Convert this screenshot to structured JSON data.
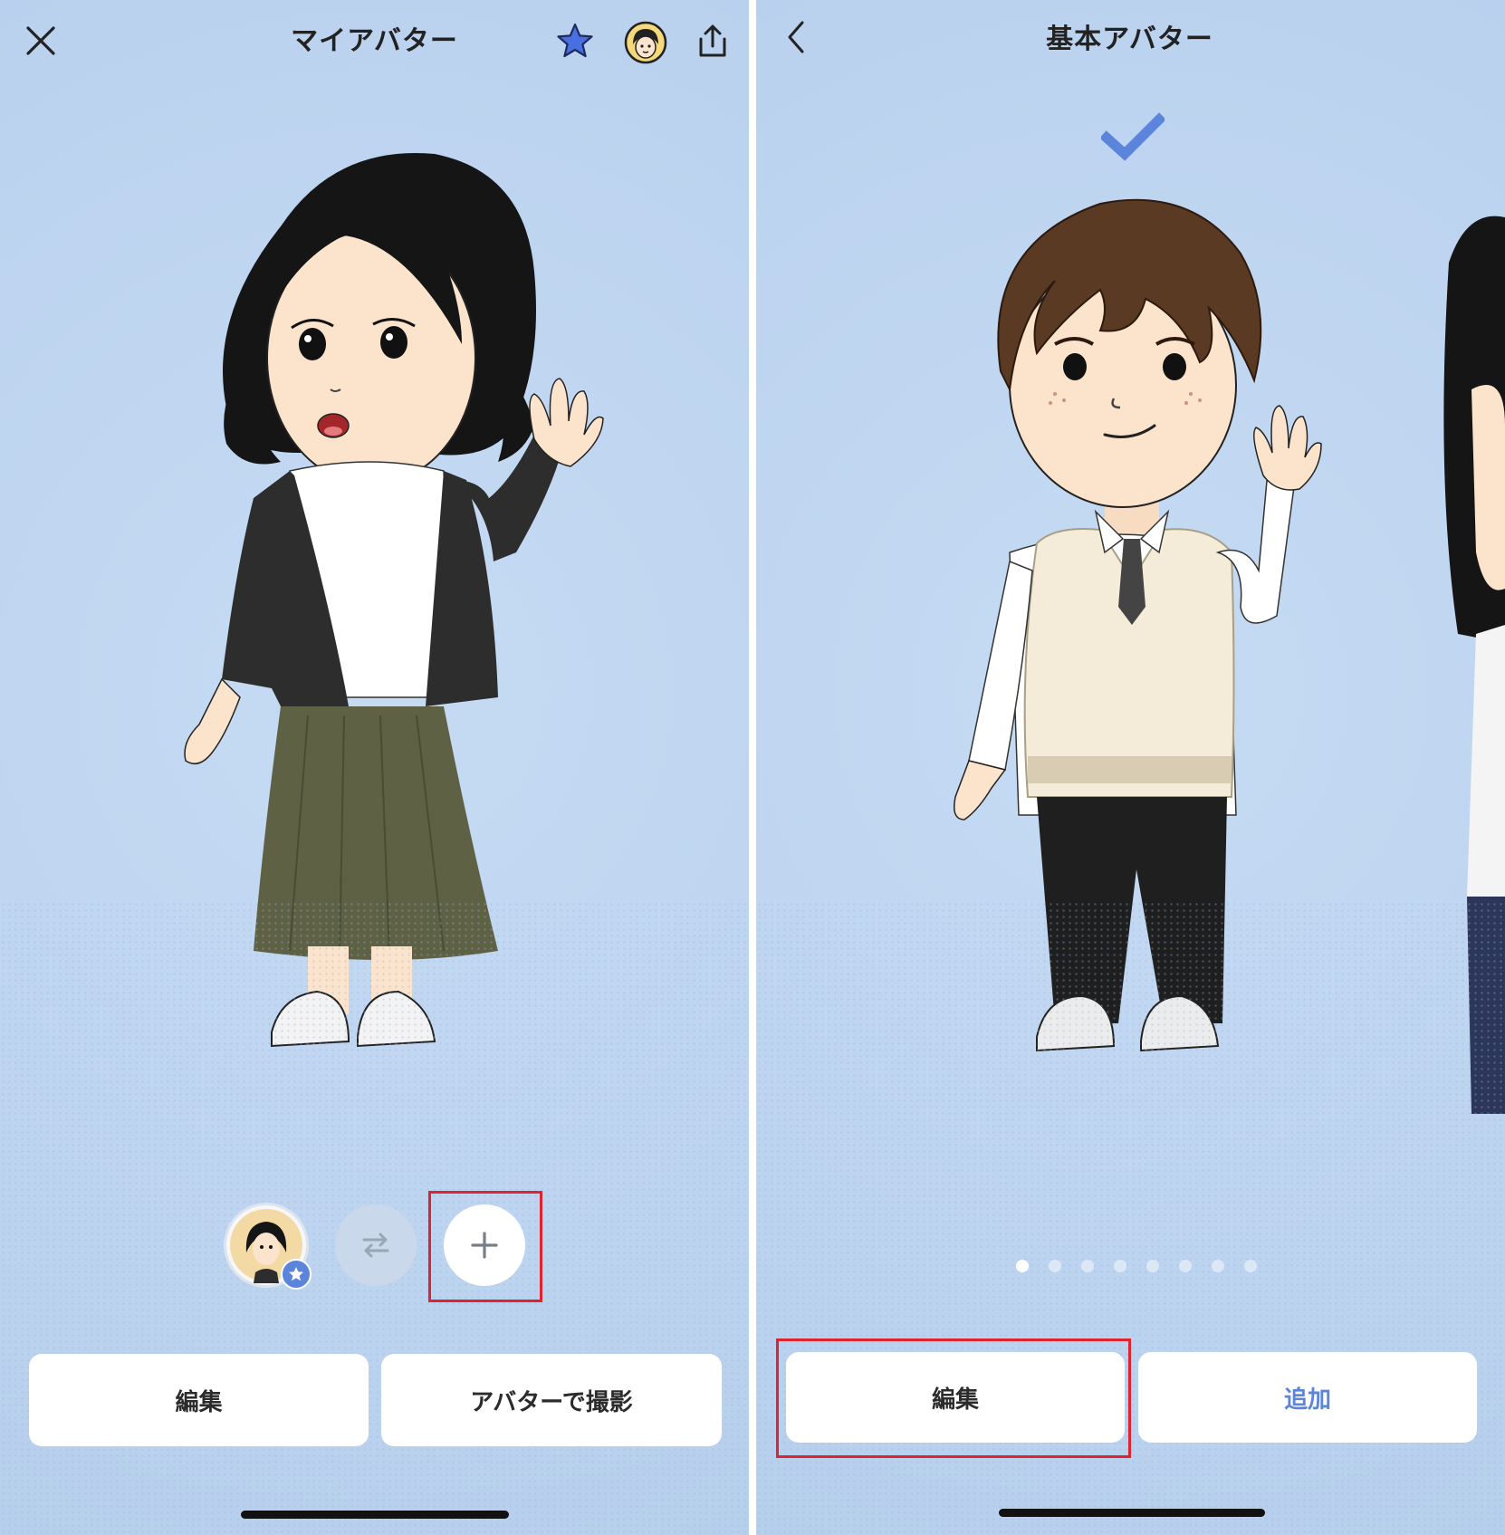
{
  "left": {
    "title": "マイアバター",
    "close_icon": "close-icon",
    "favorite_icon": "star-icon",
    "favorite_color": "#3b6fe6",
    "profile_icon": "avatar-face-icon",
    "share_icon": "share-icon",
    "swap_icon": "swap-arrows-icon",
    "add_icon": "plus-icon",
    "edit_label": "編集",
    "camera_label": "アバターで撮影"
  },
  "right": {
    "title": "基本アバター",
    "back_icon": "chevron-left-icon",
    "check_icon": "check-icon",
    "check_color": "#5b84db",
    "pager": {
      "count": 8,
      "active_index": 0
    },
    "edit_label": "編集",
    "add_label": "追加",
    "add_color": "#5b84db"
  },
  "highlight_color": "#e0242f"
}
